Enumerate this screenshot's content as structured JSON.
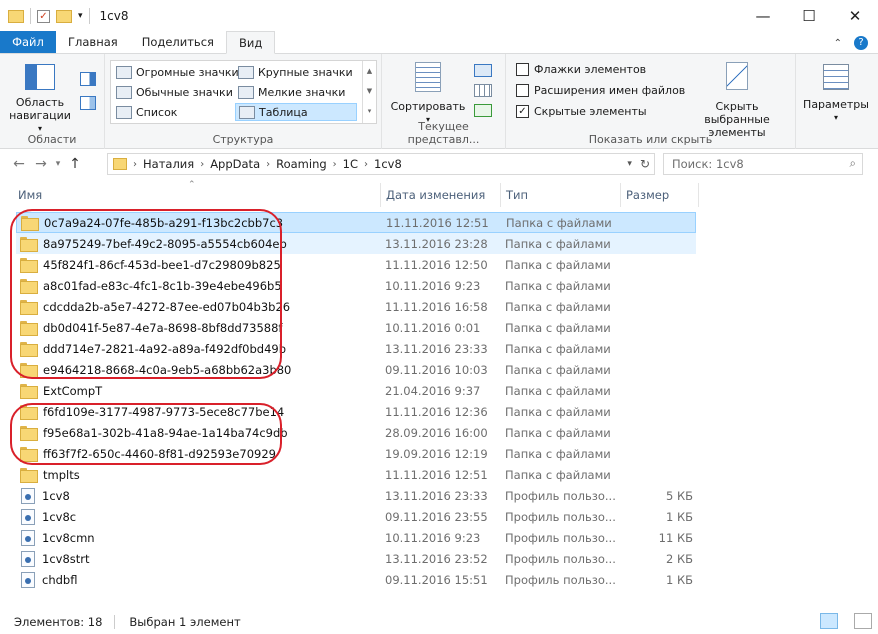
{
  "window": {
    "title": "1cv8"
  },
  "ribbon_tabs": [
    {
      "label": "Файл"
    },
    {
      "label": "Главная"
    },
    {
      "label": "Поделиться"
    },
    {
      "label": "Вид"
    }
  ],
  "ribbon": {
    "nav_pane": {
      "label_line1": "Область",
      "label_line2": "навигации"
    },
    "group_panes": "Области",
    "layout": {
      "huge": "Огромные значки",
      "large": "Крупные значки",
      "normal": "Обычные значки",
      "small": "Мелкие значки",
      "list": "Список",
      "table": "Таблица"
    },
    "group_structure": "Структура",
    "sort_label": "Сортировать",
    "group_current_view": "Текущее представл...",
    "checkboxes": {
      "item_flags": "Флажки элементов",
      "extensions": "Расширения имен файлов",
      "hidden": "Скрытые элементы"
    },
    "hide_selected_line1": "Скрыть выбранные",
    "hide_selected_line2": "элементы",
    "group_show_hide": "Показать или скрыть",
    "options": "Параметры"
  },
  "address": {
    "crumbs": [
      "Наталия",
      "AppData",
      "Roaming",
      "1C",
      "1cv8"
    ],
    "search_placeholder": "Поиск: 1cv8"
  },
  "columns": {
    "name": "Имя",
    "date": "Дата изменения",
    "type": "Тип",
    "size": "Размер"
  },
  "files": [
    {
      "name": "0c7a9a24-07fe-485b-a291-f13bc2cbb7c3",
      "date": "11.11.2016 12:51",
      "type": "Папка с файлами",
      "size": "",
      "kind": "folder"
    },
    {
      "name": "8a975249-7bef-49c2-8095-a5554cb604eb",
      "date": "13.11.2016 23:28",
      "type": "Папка с файлами",
      "size": "",
      "kind": "folder"
    },
    {
      "name": "45f824f1-86cf-453d-bee1-d7c29809b825",
      "date": "11.11.2016 12:50",
      "type": "Папка с файлами",
      "size": "",
      "kind": "folder"
    },
    {
      "name": "a8c01fad-e83c-4fc1-8c1b-39e4ebe496b5",
      "date": "10.11.2016 9:23",
      "type": "Папка с файлами",
      "size": "",
      "kind": "folder"
    },
    {
      "name": "cdcdda2b-a5e7-4272-87ee-ed07b04b3b26",
      "date": "11.11.2016 16:58",
      "type": "Папка с файлами",
      "size": "",
      "kind": "folder"
    },
    {
      "name": "db0d041f-5e87-4e7a-8698-8bf8dd73588f",
      "date": "10.11.2016 0:01",
      "type": "Папка с файлами",
      "size": "",
      "kind": "folder"
    },
    {
      "name": "ddd714e7-2821-4a92-a89a-f492df0bd49b",
      "date": "13.11.2016 23:33",
      "type": "Папка с файлами",
      "size": "",
      "kind": "folder"
    },
    {
      "name": "e9464218-8668-4c0a-9eb5-a68bb62a3b80",
      "date": "09.11.2016 10:03",
      "type": "Папка с файлами",
      "size": "",
      "kind": "folder"
    },
    {
      "name": "ExtCompT",
      "date": "21.04.2016 9:37",
      "type": "Папка с файлами",
      "size": "",
      "kind": "folder"
    },
    {
      "name": "f6fd109e-3177-4987-9773-5ece8c77be14",
      "date": "11.11.2016 12:36",
      "type": "Папка с файлами",
      "size": "",
      "kind": "folder"
    },
    {
      "name": "f95e68a1-302b-41a8-94ae-1a14ba74c9db",
      "date": "28.09.2016 16:00",
      "type": "Папка с файлами",
      "size": "",
      "kind": "folder"
    },
    {
      "name": "ff63f7f2-650c-4460-8f81-d92593e70929",
      "date": "19.09.2016 12:19",
      "type": "Папка с файлами",
      "size": "",
      "kind": "folder"
    },
    {
      "name": "tmplts",
      "date": "11.11.2016 12:51",
      "type": "Папка с файлами",
      "size": "",
      "kind": "folder"
    },
    {
      "name": "1cv8",
      "date": "13.11.2016 23:33",
      "type": "Профиль пользо...",
      "size": "5 КБ",
      "kind": "profile"
    },
    {
      "name": "1cv8c",
      "date": "09.11.2016 23:55",
      "type": "Профиль пользо...",
      "size": "1 КБ",
      "kind": "profile"
    },
    {
      "name": "1cv8cmn",
      "date": "10.11.2016 9:23",
      "type": "Профиль пользо...",
      "size": "11 КБ",
      "kind": "profile"
    },
    {
      "name": "1cv8strt",
      "date": "13.11.2016 23:52",
      "type": "Профиль пользо...",
      "size": "2 КБ",
      "kind": "profile"
    },
    {
      "name": "chdbfl",
      "date": "09.11.2016 15:51",
      "type": "Профиль пользо...",
      "size": "1 КБ",
      "kind": "profile"
    }
  ],
  "status": {
    "count": "Элементов: 18",
    "selected": "Выбран 1 элемент"
  },
  "colors": {
    "file_tab": "#1979ca",
    "selection": "#cce8ff",
    "highlight_ellipse": "#d9202a"
  }
}
